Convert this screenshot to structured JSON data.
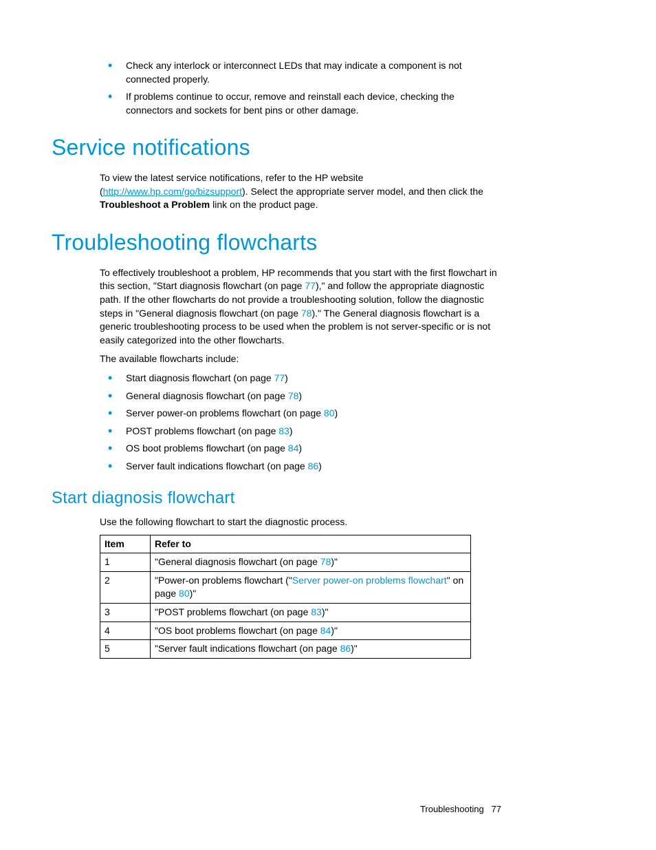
{
  "intro_bullets": {
    "b1": "Check any interlock or interconnect LEDs that may indicate a component is not connected properly.",
    "b2": "If problems continue to occur, remove and reinstall each device, checking the connectors and sockets for bent pins or other damage."
  },
  "section1": {
    "heading": "Service notifications",
    "para_pre": "To view the latest service notifications, refer to the HP website (",
    "link_text": "http://www.hp.com/go/bizsupport",
    "para_post1": "). Select the appropriate server model, and then click the ",
    "bold": "Troubleshoot a Problem",
    "para_post2": " link on the product page."
  },
  "section2": {
    "heading": "Troubleshooting flowcharts",
    "p1_a": "To effectively troubleshoot a problem, HP recommends that you start with the first flowchart in this section, \"Start diagnosis flowchart (on page ",
    "p1_pg1": "77",
    "p1_b": "),\" and follow the appropriate diagnostic path. If the other flowcharts do not provide a troubleshooting solution, follow the diagnostic steps in \"General diagnosis flowchart (on page ",
    "p1_pg2": "78",
    "p1_c": ").\" The General diagnosis flowchart is a generic troubleshooting process to be used when the problem is not server-specific or is not easily categorized into the other flowcharts.",
    "p2": "The available flowcharts include:",
    "list": {
      "i1a": "Start diagnosis flowchart (on page ",
      "i1p": "77",
      "i1b": ")",
      "i2a": "General diagnosis flowchart (on page ",
      "i2p": "78",
      "i2b": ")",
      "i3a": "Server power-on problems flowchart (on page ",
      "i3p": "80",
      "i3b": ")",
      "i4a": "POST problems flowchart (on page ",
      "i4p": "83",
      "i4b": ")",
      "i5a": "OS boot problems flowchart (on page ",
      "i5p": "84",
      "i5b": ")",
      "i6a": "Server fault indications flowchart (on page ",
      "i6p": "86",
      "i6b": ")"
    }
  },
  "section3": {
    "heading": "Start diagnosis flowchart",
    "intro": "Use the following flowchart to start the diagnostic process.",
    "table": {
      "h1": "Item",
      "h2": "Refer to",
      "r1": {
        "item": "1",
        "a": "\"General diagnosis flowchart (on page ",
        "p": "78",
        "b": ")\""
      },
      "r2": {
        "item": "2",
        "a": "\"Power-on problems flowchart (\"",
        "link": "Server power-on problems flowchart",
        "mid": "\" on page ",
        "p": "80",
        "b": ")\""
      },
      "r3": {
        "item": "3",
        "a": "\"POST problems flowchart (on page ",
        "p": "83",
        "b": ")\""
      },
      "r4": {
        "item": "4",
        "a": "\"OS boot problems flowchart (on page ",
        "p": "84",
        "b": ")\""
      },
      "r5": {
        "item": "5",
        "a": "\"Server fault indications flowchart (on page ",
        "p": "86",
        "b": ")\""
      }
    }
  },
  "footer": {
    "section": "Troubleshooting",
    "page": "77"
  }
}
